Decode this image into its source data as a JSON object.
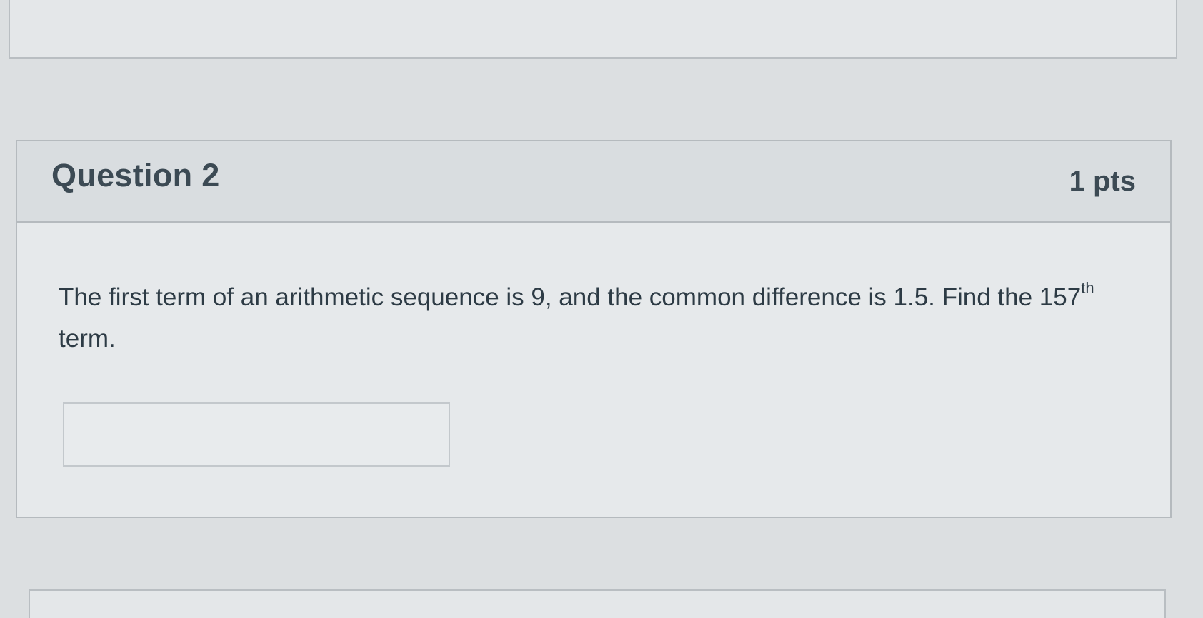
{
  "question": {
    "title": "Question 2",
    "points": "1 pts",
    "text_main": "The first term of an arithmetic sequence is 9, and the common difference is 1.5. Find the 157",
    "text_superscript": "th",
    "text_tail": " term.",
    "answer_value": ""
  }
}
